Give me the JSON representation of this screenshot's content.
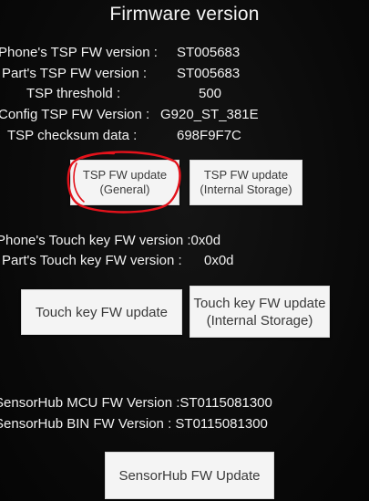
{
  "title": "Firmware version",
  "tsp_info": {
    "phone_fw_label": "Phone's TSP FW version :",
    "phone_fw_value": "ST005683",
    "part_fw_label": "Part's TSP FW version :",
    "part_fw_value": "ST005683",
    "threshold_label": "TSP threshold :",
    "threshold_value": "500",
    "config_label": "Config TSP FW Version :",
    "config_value": "G920_ST_381E",
    "checksum_label": "TSP checksum data :",
    "checksum_value": "698F9F7C"
  },
  "tsp_buttons": {
    "general": "TSP FW update\n(General)",
    "internal": "TSP FW update\n(Internal Storage)"
  },
  "touchkey_info": {
    "phone_label": "Phone's Touch key FW version :0x0d",
    "part_label": "Part's Touch key FW version :",
    "part_value": "0x0d"
  },
  "touchkey_buttons": {
    "update": "Touch key FW update",
    "internal": "Touch key FW update\n(Internal Storage)"
  },
  "sensorhub_info": {
    "mcu_label": "SensorHub MCU FW Version :ST0115081300",
    "bin_label": "SensorHub BIN FW Version : ST0115081300"
  },
  "sensorhub_button": {
    "update": "SensorHub FW Update"
  },
  "colors": {
    "background": "#0c0c0c",
    "text": "#f0f0f0",
    "button_bg": "#f4f4f4",
    "button_text": "#3a3a3a",
    "annotation_circle": "#e3121b"
  }
}
